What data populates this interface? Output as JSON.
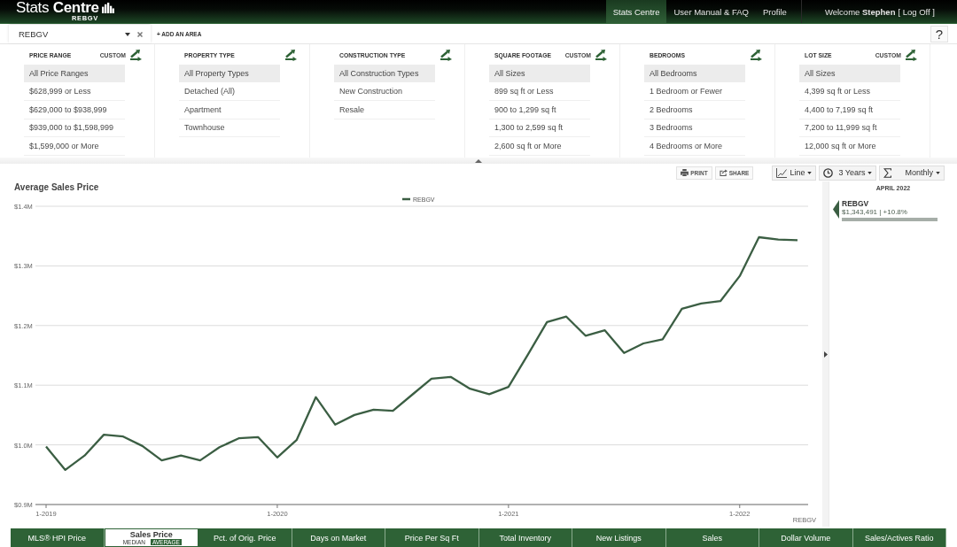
{
  "header": {
    "logo": {
      "title": "Stats **Centre**",
      "subtitle": "REBGV"
    },
    "nav": [
      {
        "label": "Stats Centre",
        "selected": true
      },
      {
        "label": "User Manual & FAQ",
        "selected": false
      },
      {
        "label": "Profile",
        "selected": false
      }
    ],
    "welcome": "Welcome **Stephen**",
    "log_off": "[ Log Off ]"
  },
  "area_bar": {
    "areas": [
      {
        "value": "REBGV"
      }
    ],
    "add_area": "+ ADD AN AREA",
    "help": "?"
  },
  "filters": [
    {
      "label": "PRICE RANGE",
      "custom": "CUSTOM",
      "options": [
        {
          "label": "All Price Ranges",
          "selected": true
        },
        {
          "label": "$628,999 or Less",
          "selected": false
        },
        {
          "label": "$629,000 to $938,999",
          "selected": false
        },
        {
          "label": "$939,000 to $1,598,999",
          "selected": false
        },
        {
          "label": "$1,599,000 or More",
          "selected": false
        }
      ]
    },
    {
      "label": "PROPERTY TYPE",
      "options": [
        {
          "label": "All Property Types",
          "selected": true
        },
        {
          "label": "Detached (All)",
          "selected": false
        },
        {
          "label": "Apartment",
          "selected": false
        },
        {
          "label": "Townhouse",
          "selected": false
        }
      ]
    },
    {
      "label": "CONSTRUCTION TYPE",
      "options": [
        {
          "label": "All Construction Types",
          "selected": true
        },
        {
          "label": "New Construction",
          "selected": false
        },
        {
          "label": "Resale",
          "selected": false
        }
      ]
    },
    {
      "label": "SQUARE FOOTAGE",
      "custom": "CUSTOM",
      "options": [
        {
          "label": "All Sizes",
          "selected": true
        },
        {
          "label": "899 sq ft or Less",
          "selected": false
        },
        {
          "label": "900 to 1,299 sq ft",
          "selected": false
        },
        {
          "label": "1,300 to 2,599 sq ft",
          "selected": false
        },
        {
          "label": "2,600 sq ft or More",
          "selected": false
        }
      ]
    },
    {
      "label": "BEDROOMS",
      "options": [
        {
          "label": "All Bedrooms",
          "selected": true
        },
        {
          "label": "1 Bedroom or Fewer",
          "selected": false
        },
        {
          "label": "2 Bedrooms",
          "selected": false
        },
        {
          "label": "3 Bedrooms",
          "selected": false
        },
        {
          "label": "4 Bedrooms or More",
          "selected": false
        }
      ]
    },
    {
      "label": "LOT SIZE",
      "custom": "CUSTOM",
      "options": [
        {
          "label": "All Sizes",
          "selected": true
        },
        {
          "label": "4,399 sq ft or Less",
          "selected": false
        },
        {
          "label": "4,400 to 7,199 sq ft",
          "selected": false
        },
        {
          "label": "7,200 to 11,999 sq ft",
          "selected": false
        },
        {
          "label": "12,000 sq ft or More",
          "selected": false
        }
      ]
    }
  ],
  "toolbar": {
    "print": "PRINT",
    "share": "SHARE",
    "chart_type": "Line",
    "period": "3 Years",
    "interval": "Monthly"
  },
  "chart": {
    "credit": "REBGV",
    "chart_data": {
      "type": "line",
      "title": "Average Sales Price",
      "categories": [
        "1-2019",
        null,
        null,
        null,
        null,
        null,
        null,
        null,
        null,
        null,
        null,
        null,
        "1-2020",
        null,
        null,
        null,
        null,
        null,
        null,
        null,
        null,
        null,
        null,
        null,
        "1-2021",
        null,
        null,
        null,
        null,
        null,
        null,
        null,
        null,
        null,
        null,
        null,
        "1-2022",
        null,
        null,
        null
      ],
      "series": [
        {
          "name": "REBGV",
          "color": "#3b5e43",
          "values": [
            997000,
            958000,
            982000,
            1017000,
            1014000,
            998000,
            974000,
            982000,
            974000,
            996000,
            1011000,
            1013000,
            979000,
            1008000,
            1080000,
            1034000,
            1050000,
            1059000,
            1057000,
            1084000,
            1111000,
            1114000,
            1094000,
            1085000,
            1097000,
            1151000,
            1206000,
            1215000,
            1183000,
            1192000,
            1154000,
            1170000,
            1177000,
            1228000,
            1237000,
            1241000,
            1283000,
            1348000,
            1344000,
            1343000
          ]
        }
      ],
      "ylim": [
        900000,
        1400000
      ],
      "yticks": [
        {
          "value": 900000,
          "label": "$0.9M"
        },
        {
          "value": 1000000,
          "label": "$1.0M"
        },
        {
          "value": 1100000,
          "label": "$1.1M"
        },
        {
          "value": 1200000,
          "label": "$1.2M"
        },
        {
          "value": 1300000,
          "label": "$1.3M"
        },
        {
          "value": 1400000,
          "label": "$1.4M"
        }
      ],
      "grid": true
    }
  },
  "details": {
    "date": "APRIL 2022",
    "entries": [
      {
        "name": "REBGV",
        "reading": "$1,343,491 | +10.8%"
      }
    ]
  },
  "metric_tabs": [
    {
      "label": "MLS® HPI Price",
      "selected": false
    },
    {
      "label": "Sales Price",
      "selected": true,
      "options": [
        {
          "label": "MEDIAN",
          "selected": false
        },
        {
          "label": "AVERAGE",
          "selected": true
        }
      ]
    },
    {
      "label": "Pct. of Orig. Price",
      "selected": false
    },
    {
      "label": "Days on Market",
      "selected": false
    },
    {
      "label": "Price Per Sq Ft",
      "selected": false
    },
    {
      "label": "Total Inventory",
      "selected": false
    },
    {
      "label": "New Listings",
      "selected": false
    },
    {
      "label": "Sales",
      "selected": false
    },
    {
      "label": "Dollar Volume",
      "selected": false
    },
    {
      "label": "Sales/Actives Ratio",
      "selected": false
    }
  ]
}
